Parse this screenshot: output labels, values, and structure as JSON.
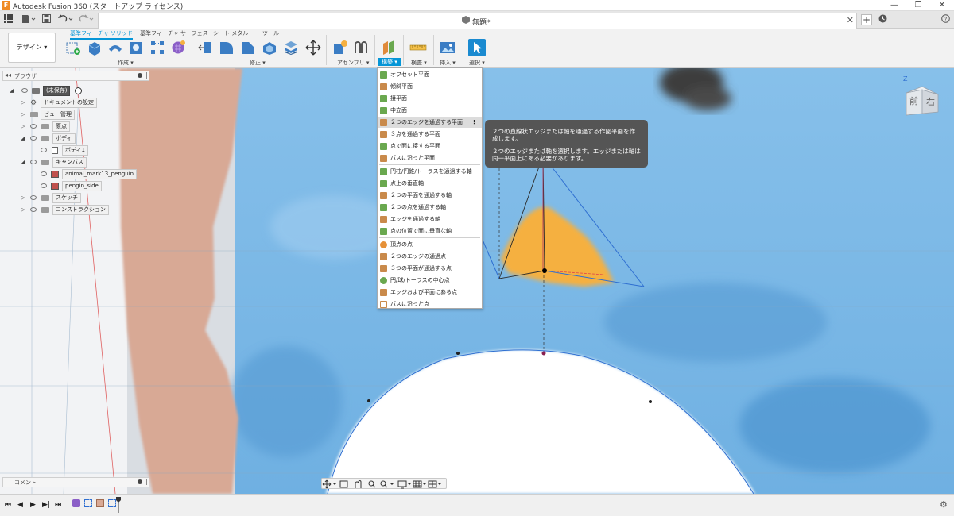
{
  "app": {
    "title": "Autodesk Fusion 360 (スタートアップ ライセンス)",
    "logo": "F"
  },
  "window_controls": {
    "minimize": "—",
    "restore": "❐",
    "close": "✕"
  },
  "tabbar": {
    "document_tab_label": "無題*",
    "close": "✕",
    "new_tab": "+"
  },
  "toolbar": {
    "design_button": "デザイン ▾",
    "workspace_tabs": [
      "基準フィーチャ ソリッド",
      "基準フィーチャ サーフェス",
      "シート メタル",
      "ツール"
    ],
    "groups": {
      "create": "作成 ▾",
      "modify": "修正 ▾",
      "assemble": "アセンブリ ▾",
      "construct": "構築 ▾",
      "inspect": "検査 ▾",
      "insert": "挿入 ▾",
      "select": "選択 ▾"
    }
  },
  "browser": {
    "title": "ブラウザ",
    "items": [
      {
        "label": "(未保存)",
        "level": 0
      },
      {
        "label": "ドキュメントの設定",
        "level": 1
      },
      {
        "label": "ビュー管理",
        "level": 1
      },
      {
        "label": "原点",
        "level": 1
      },
      {
        "label": "ボディ",
        "level": 1
      },
      {
        "label": "ボディ1",
        "level": 2
      },
      {
        "label": "キャンバス",
        "level": 1
      },
      {
        "label": "animal_mark13_penguin",
        "level": 2
      },
      {
        "label": "pengin_side",
        "level": 2
      },
      {
        "label": "スケッチ",
        "level": 1
      },
      {
        "label": "コンストラクション",
        "level": 1
      }
    ]
  },
  "construct_menu": {
    "items": [
      {
        "label": "オフセット平面",
        "color": "#6aa84f"
      },
      {
        "label": "傾斜平面",
        "color": "#c98a4b"
      },
      {
        "label": "接平面",
        "color": "#6aa84f"
      },
      {
        "label": "中立面",
        "color": "#6aa84f"
      },
      {
        "label": "２つのエッジを通過する平面",
        "color": "#c98a4b",
        "highlighted": true,
        "more": "⋮"
      },
      {
        "label": "３点を通過する平面",
        "color": "#c98a4b"
      },
      {
        "label": "点で面に接する平面",
        "color": "#6aa84f"
      },
      {
        "label": "パスに沿った平面",
        "color": "#c98a4b"
      },
      {
        "label": "円柱/円錐/トーラスを通過する軸",
        "color": "#6aa84f"
      },
      {
        "label": "点上の垂直軸",
        "color": "#6aa84f"
      },
      {
        "label": "２つの平面を通過する軸",
        "color": "#c98a4b"
      },
      {
        "label": "２つの点を通過する軸",
        "color": "#6aa84f"
      },
      {
        "label": "エッジを通過する軸",
        "color": "#c98a4b"
      },
      {
        "label": "点の位置で面に垂直な軸",
        "color": "#6aa84f"
      },
      {
        "label": "頂点の点",
        "color": "#e69138"
      },
      {
        "label": "２つのエッジの通過点",
        "color": "#c98a4b"
      },
      {
        "label": "３つの平面が通過する点",
        "color": "#c98a4b"
      },
      {
        "label": "円/球/トーラスの中心点",
        "color": "#6aa84f"
      },
      {
        "label": "エッジおよび平面にある点",
        "color": "#c98a4b"
      },
      {
        "label": "パスに沿った点",
        "color": "#c98a4b"
      }
    ]
  },
  "tooltip": {
    "line1": "２つの直線状エッジまたは軸を通過する作図平面を作成します。",
    "line2": "２つのエッジまたは軸を選択します。エッジまたは軸は同一平面上にある必要があります。"
  },
  "viewcube": {
    "front": "前",
    "right": "右",
    "z": "Z"
  },
  "comments": {
    "label": "コメント"
  },
  "colors": {
    "accent": "#0696d7",
    "sky": "#8fc3ea",
    "ground": "#5fa3d9",
    "canvas_pink": "#d8a995",
    "highlight_orange": "#f5b041"
  }
}
